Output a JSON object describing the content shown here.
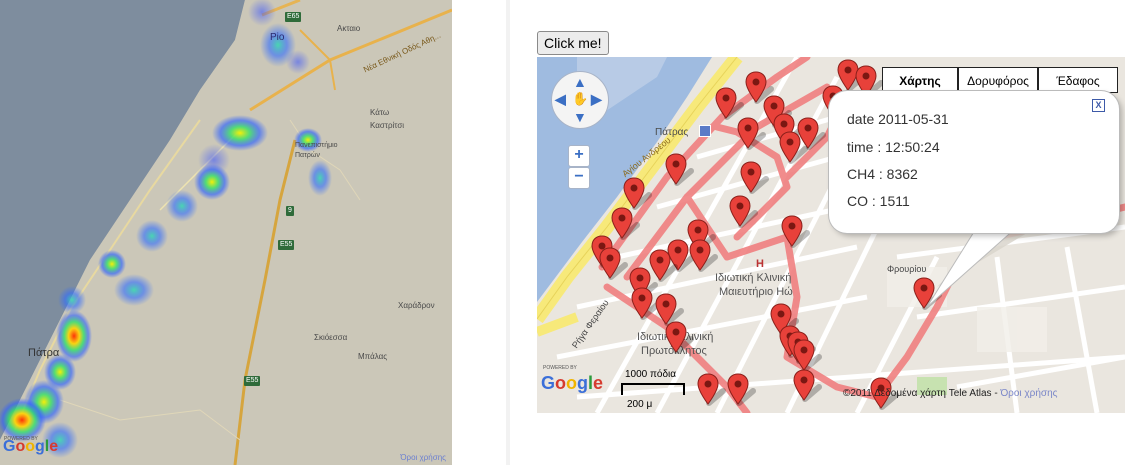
{
  "heatmap": {
    "labels": {
      "e65": "E65",
      "pio": "Pio",
      "aktaio": "Ακταιο",
      "national_road": "Νέα Εθνική Οδός Αθη...",
      "kato_kastritsi": "Κάτω\nΚαστρίτσι",
      "panepistimio": "Πανεπιστήμιο\nΠατρών",
      "e55": "E55",
      "road9": "9",
      "skioessa": "Σκιόεσσα",
      "charadron": "Χαράδρον",
      "mpalas": "Μπάλας",
      "patra": "Πάτρα",
      "e55_lower": "E55"
    },
    "powered_by": "POWERED BY",
    "google": [
      "G",
      "o",
      "o",
      "g",
      "l",
      "e"
    ],
    "terms": "Όροι χρήσης"
  },
  "right_map": {
    "click_button": "Click me!",
    "map_types": {
      "map": "Χάρτης",
      "satellite": "Δορυφόρος",
      "terrain": "Έδαφος"
    },
    "pan_icon": "hand-pan-icon",
    "zoom_in": "+",
    "zoom_out": "−",
    "info_window": {
      "date_line": "date 2011-05-31",
      "time_line": "time :  12:50:24",
      "ch4_line": "CH4 :  8362",
      "co_line": "CO :  1511",
      "close": "X"
    },
    "labels": {
      "patras_station": "Πάτρας",
      "agiou_andreou": "Αγίου Ανδρέου",
      "klinik_1": "Ιδιωτική Κλινική",
      "klinik_2": "Μαιευτήριο Ηώ",
      "klinik_3": "Ιδιωτική Κλινική",
      "klinik_4": "Πρωτόκλητος",
      "frouriou": "Φρουρίου",
      "rigas": "Ρήγα Φεραίου",
      "hospital_h": "H"
    },
    "powered_by": "POWERED BY",
    "google": [
      "G",
      "o",
      "o",
      "g",
      "l",
      "e"
    ],
    "scale_top": "1000 πόδια",
    "scale_bottom": "200 μ",
    "copyright": "©2011 Δεδομένα χάρτη Tele Atlas - ",
    "copyright_terms": "Όροι χρήσης"
  }
}
